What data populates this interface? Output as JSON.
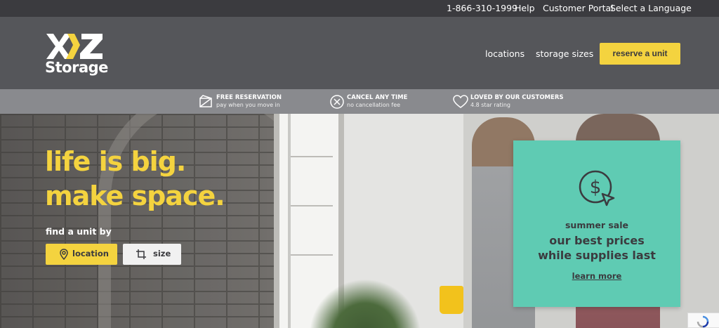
{
  "utility": {
    "phone": "1-866-310-1999",
    "help": "Help",
    "customer_portal": "Customer Portal",
    "language": "Select a Language"
  },
  "header": {
    "logo_word": "Storage",
    "nav": {
      "locations": "locations",
      "storage_sizes": "storage sizes"
    },
    "reserve_label": "reserve a unit"
  },
  "benefits": [
    {
      "title": "FREE RESERVATION",
      "sub": "pay when you move in",
      "icon": "reservation-icon"
    },
    {
      "title": "CANCEL ANY TIME",
      "sub": "no cancellation fee",
      "icon": "cancel-icon"
    },
    {
      "title": "LOVED BY OUR CUSTOMERS",
      "sub": "4.8 star rating",
      "icon": "heart-icon"
    }
  ],
  "hero": {
    "headline_line1": "life is big.",
    "headline_line2": "make space.",
    "find_label": "find a unit by",
    "location_label": "location",
    "size_label": "size"
  },
  "promo": {
    "kicker": "summer sale",
    "headline_line1": "our best prices",
    "headline_line2": "while supplies last",
    "link": "learn more"
  },
  "colors": {
    "accent_yellow": "#f4d33f",
    "header_gray": "#55565a",
    "utility_gray": "#3b3b3f",
    "promo_teal": "#5fcbb3"
  }
}
